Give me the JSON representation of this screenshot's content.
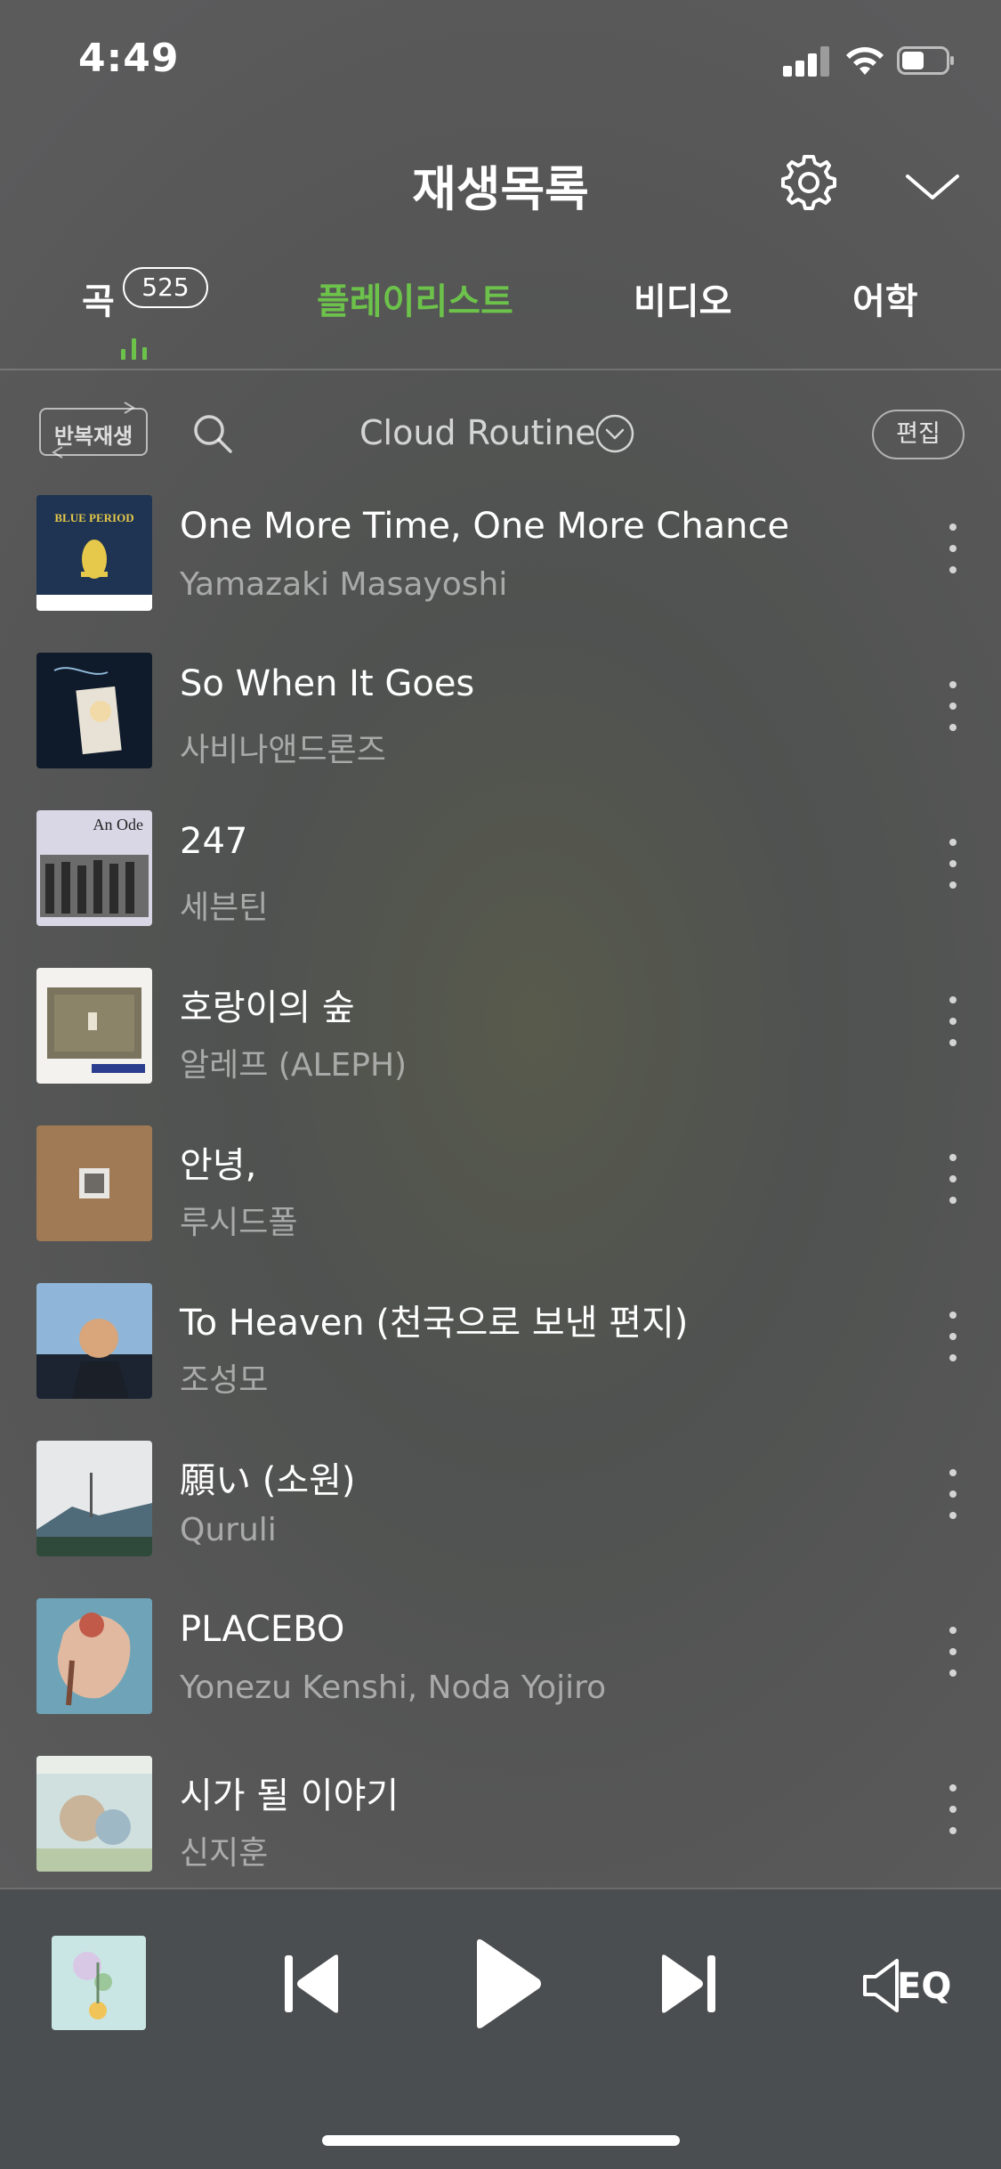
{
  "status_bar": {
    "time": "4:49"
  },
  "header": {
    "title": "재생목록"
  },
  "tabs": [
    {
      "label": "곡",
      "count": "525"
    },
    {
      "label": "플레이리스트"
    },
    {
      "label": "비디오"
    },
    {
      "label": "어학"
    }
  ],
  "toolbar": {
    "repeat_label": "반복재생",
    "playlist_name": "Cloud Routine",
    "edit_label": "편집"
  },
  "songs": [
    {
      "title": "One More Time, One More Chance",
      "artist": "Yamazaki Masayoshi"
    },
    {
      "title": "So When It Goes",
      "artist": "사비나앤드론즈"
    },
    {
      "title": "247",
      "artist": "세븐틴"
    },
    {
      "title": "호랑이의 숲",
      "artist": "알레프 (ALEPH)"
    },
    {
      "title": "안녕,",
      "artist": "루시드폴"
    },
    {
      "title": "To Heaven (천국으로 보낸 편지)",
      "artist": "조성모"
    },
    {
      "title": "願い (소원)",
      "artist": "Quruli"
    },
    {
      "title": "PLACEBO",
      "artist": "Yonezu Kenshi, Noda Yojiro"
    },
    {
      "title": "시가 될 이야기",
      "artist": "신지훈"
    }
  ],
  "album_art_text": {
    "song1": "BLUE PERIOD",
    "song3": "An Ode"
  },
  "player": {
    "eq_label": "EQ"
  },
  "colors": {
    "accent": "#6cc24a"
  }
}
